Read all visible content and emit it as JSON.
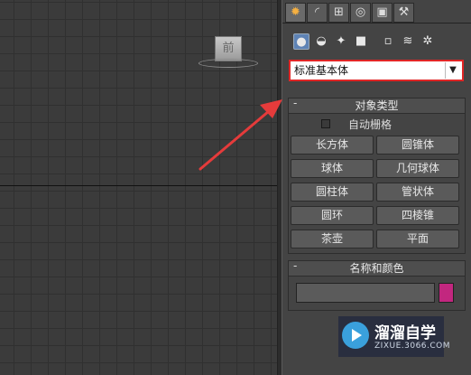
{
  "viewport": {
    "viewcube_label": "前"
  },
  "command_panel": {
    "tabs": [
      {
        "name": "create",
        "icon": "sun-icon",
        "glyph": "✹"
      },
      {
        "name": "modify",
        "icon": "curve-icon",
        "glyph": "◜"
      },
      {
        "name": "hierarchy",
        "icon": "hierarchy-icon",
        "glyph": "⊞"
      },
      {
        "name": "motion",
        "icon": "motion-icon",
        "glyph": "◎"
      },
      {
        "name": "display",
        "icon": "display-icon",
        "glyph": "▣"
      },
      {
        "name": "utilities",
        "icon": "hammer-icon",
        "glyph": "⚒"
      }
    ],
    "create_tools": [
      {
        "name": "geometry",
        "icon": "sphere-icon",
        "glyph": "●"
      },
      {
        "name": "shapes",
        "icon": "shapes-icon",
        "glyph": "◒"
      },
      {
        "name": "lights",
        "icon": "light-icon",
        "glyph": "✦"
      },
      {
        "name": "cameras",
        "icon": "camera-icon",
        "glyph": "■"
      },
      {
        "name": "helpers",
        "icon": "helper-icon",
        "glyph": "▫"
      },
      {
        "name": "space-warps",
        "icon": "wave-icon",
        "glyph": "≋"
      },
      {
        "name": "systems",
        "icon": "gear-icon",
        "glyph": "✲"
      }
    ],
    "category_dropdown": {
      "value": "标准基本体",
      "arrow": "▼"
    },
    "object_type": {
      "title": "对象类型",
      "collapse": "-",
      "autogrid_label": "自动栅格",
      "autogrid_checked": false,
      "buttons": [
        "长方体",
        "圆锥体",
        "球体",
        "几何球体",
        "圆柱体",
        "管状体",
        "圆环",
        "四棱锥",
        "茶壶",
        "平面"
      ]
    },
    "name_color": {
      "title": "名称和颜色",
      "collapse": "-",
      "name_value": "",
      "color": "#c2277f"
    }
  },
  "watermark": {
    "title": "溜溜自学",
    "subtitle": "ZIXUE.3066.COM"
  },
  "annotation": {
    "arrow_color": "#e53b3b"
  }
}
